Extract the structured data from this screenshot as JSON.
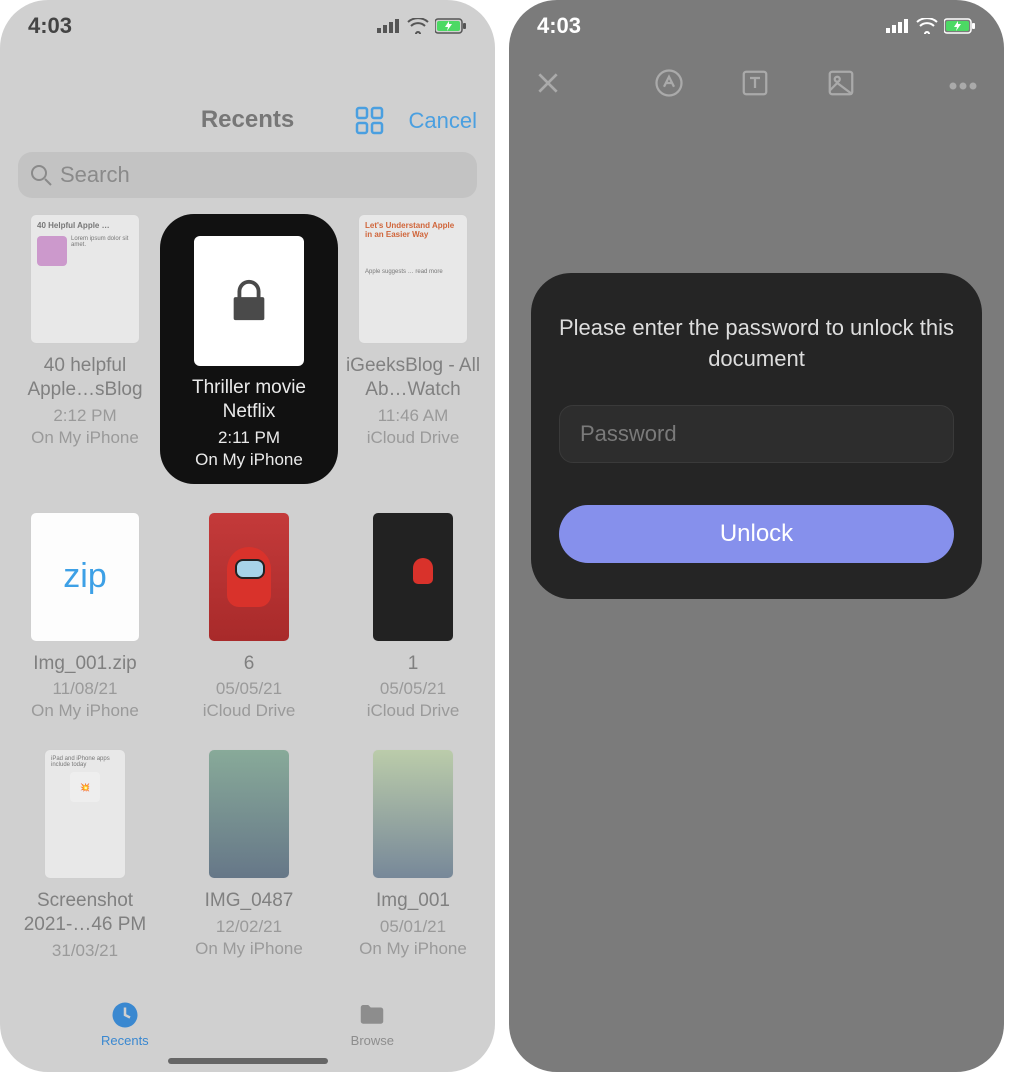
{
  "statusbar": {
    "time": "4:03"
  },
  "left": {
    "header": {
      "title": "Recents",
      "cancel": "Cancel"
    },
    "search": {
      "placeholder": "Search"
    },
    "files": [
      {
        "name": "40 helpful Apple…sBlog",
        "time": "2:12 PM",
        "location": "On My iPhone"
      },
      {
        "name": "Thriller movie Netflix",
        "time": "2:11 PM",
        "location": "On My iPhone",
        "highlighted": true
      },
      {
        "name": "iGeeksBlog - All Ab…Watch",
        "time": "11:46 AM",
        "location": "iCloud Drive"
      },
      {
        "name": "Img_001.zip",
        "time": "11/08/21",
        "location": "On My iPhone"
      },
      {
        "name": "6",
        "time": "05/05/21",
        "location": "iCloud Drive"
      },
      {
        "name": "1",
        "time": "05/05/21",
        "location": "iCloud Drive"
      },
      {
        "name": "Screenshot 2021-…46 PM",
        "time": "31/03/21",
        "location": ""
      },
      {
        "name": "IMG_0487",
        "time": "12/02/21",
        "location": "On My iPhone"
      },
      {
        "name": "Img_001",
        "time": "05/01/21",
        "location": "On My iPhone"
      }
    ],
    "tabs": {
      "recents": "Recents",
      "browse": "Browse"
    }
  },
  "right": {
    "unlock": {
      "message": "Please enter the password to unlock this document",
      "placeholder": "Password",
      "button": "Unlock"
    }
  }
}
